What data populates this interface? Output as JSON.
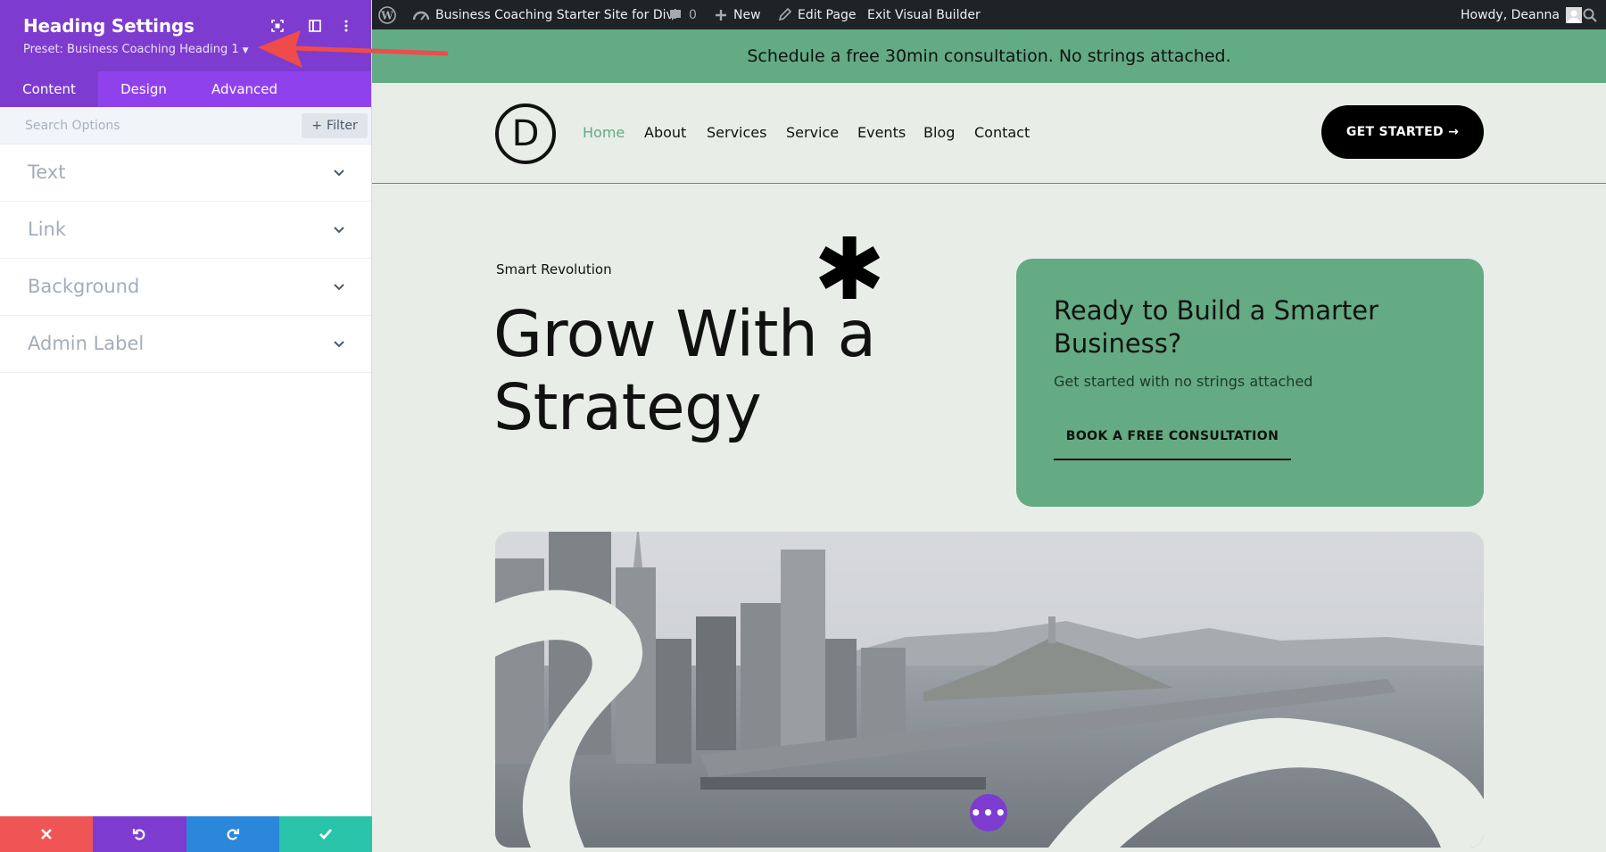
{
  "panel": {
    "title": "Heading Settings",
    "preset": "Preset: Business Coaching Heading 1",
    "tabs": [
      {
        "label": "Content",
        "active": true
      },
      {
        "label": "Design",
        "active": false
      },
      {
        "label": "Advanced",
        "active": false
      }
    ],
    "search_placeholder": "Search Options",
    "filter_label": "Filter",
    "toggles": [
      "Text",
      "Link",
      "Background",
      "Admin Label"
    ],
    "footer_colors": [
      "#ef5555",
      "#7e3bd0",
      "#2b87da",
      "#29c4a9"
    ]
  },
  "adminbar": {
    "site_name": "Business Coaching Starter Site for Divi",
    "comments_count": "0",
    "new_label": "New",
    "edit_page": "Edit Page",
    "exit_builder": "Exit Visual Builder",
    "greeting": "Howdy, Deanna"
  },
  "site": {
    "banner": "Schedule a free 30min consultation. No strings attached.",
    "logo_letter": "D",
    "nav": [
      "Home",
      "About",
      "Services",
      "Service",
      "Events",
      "Blog",
      "Contact"
    ],
    "nav_current": "Home",
    "cta_top": "GET STARTED →",
    "eyebrow": "Smart Revolution",
    "headline": "Grow With a Strategy",
    "asterisk": "✱",
    "card_title": "Ready to Build a Smarter Business?",
    "card_sub": "Get started with no strings attached",
    "card_button": "BOOK A FREE CONSULTATION"
  },
  "colors": {
    "divi_purple": "#7e3bd0",
    "tab_purple": "#8f42ec",
    "brand_green": "#63ab84",
    "page_bg": "#e8ede7",
    "annotation_red": "#ef4b4b"
  }
}
